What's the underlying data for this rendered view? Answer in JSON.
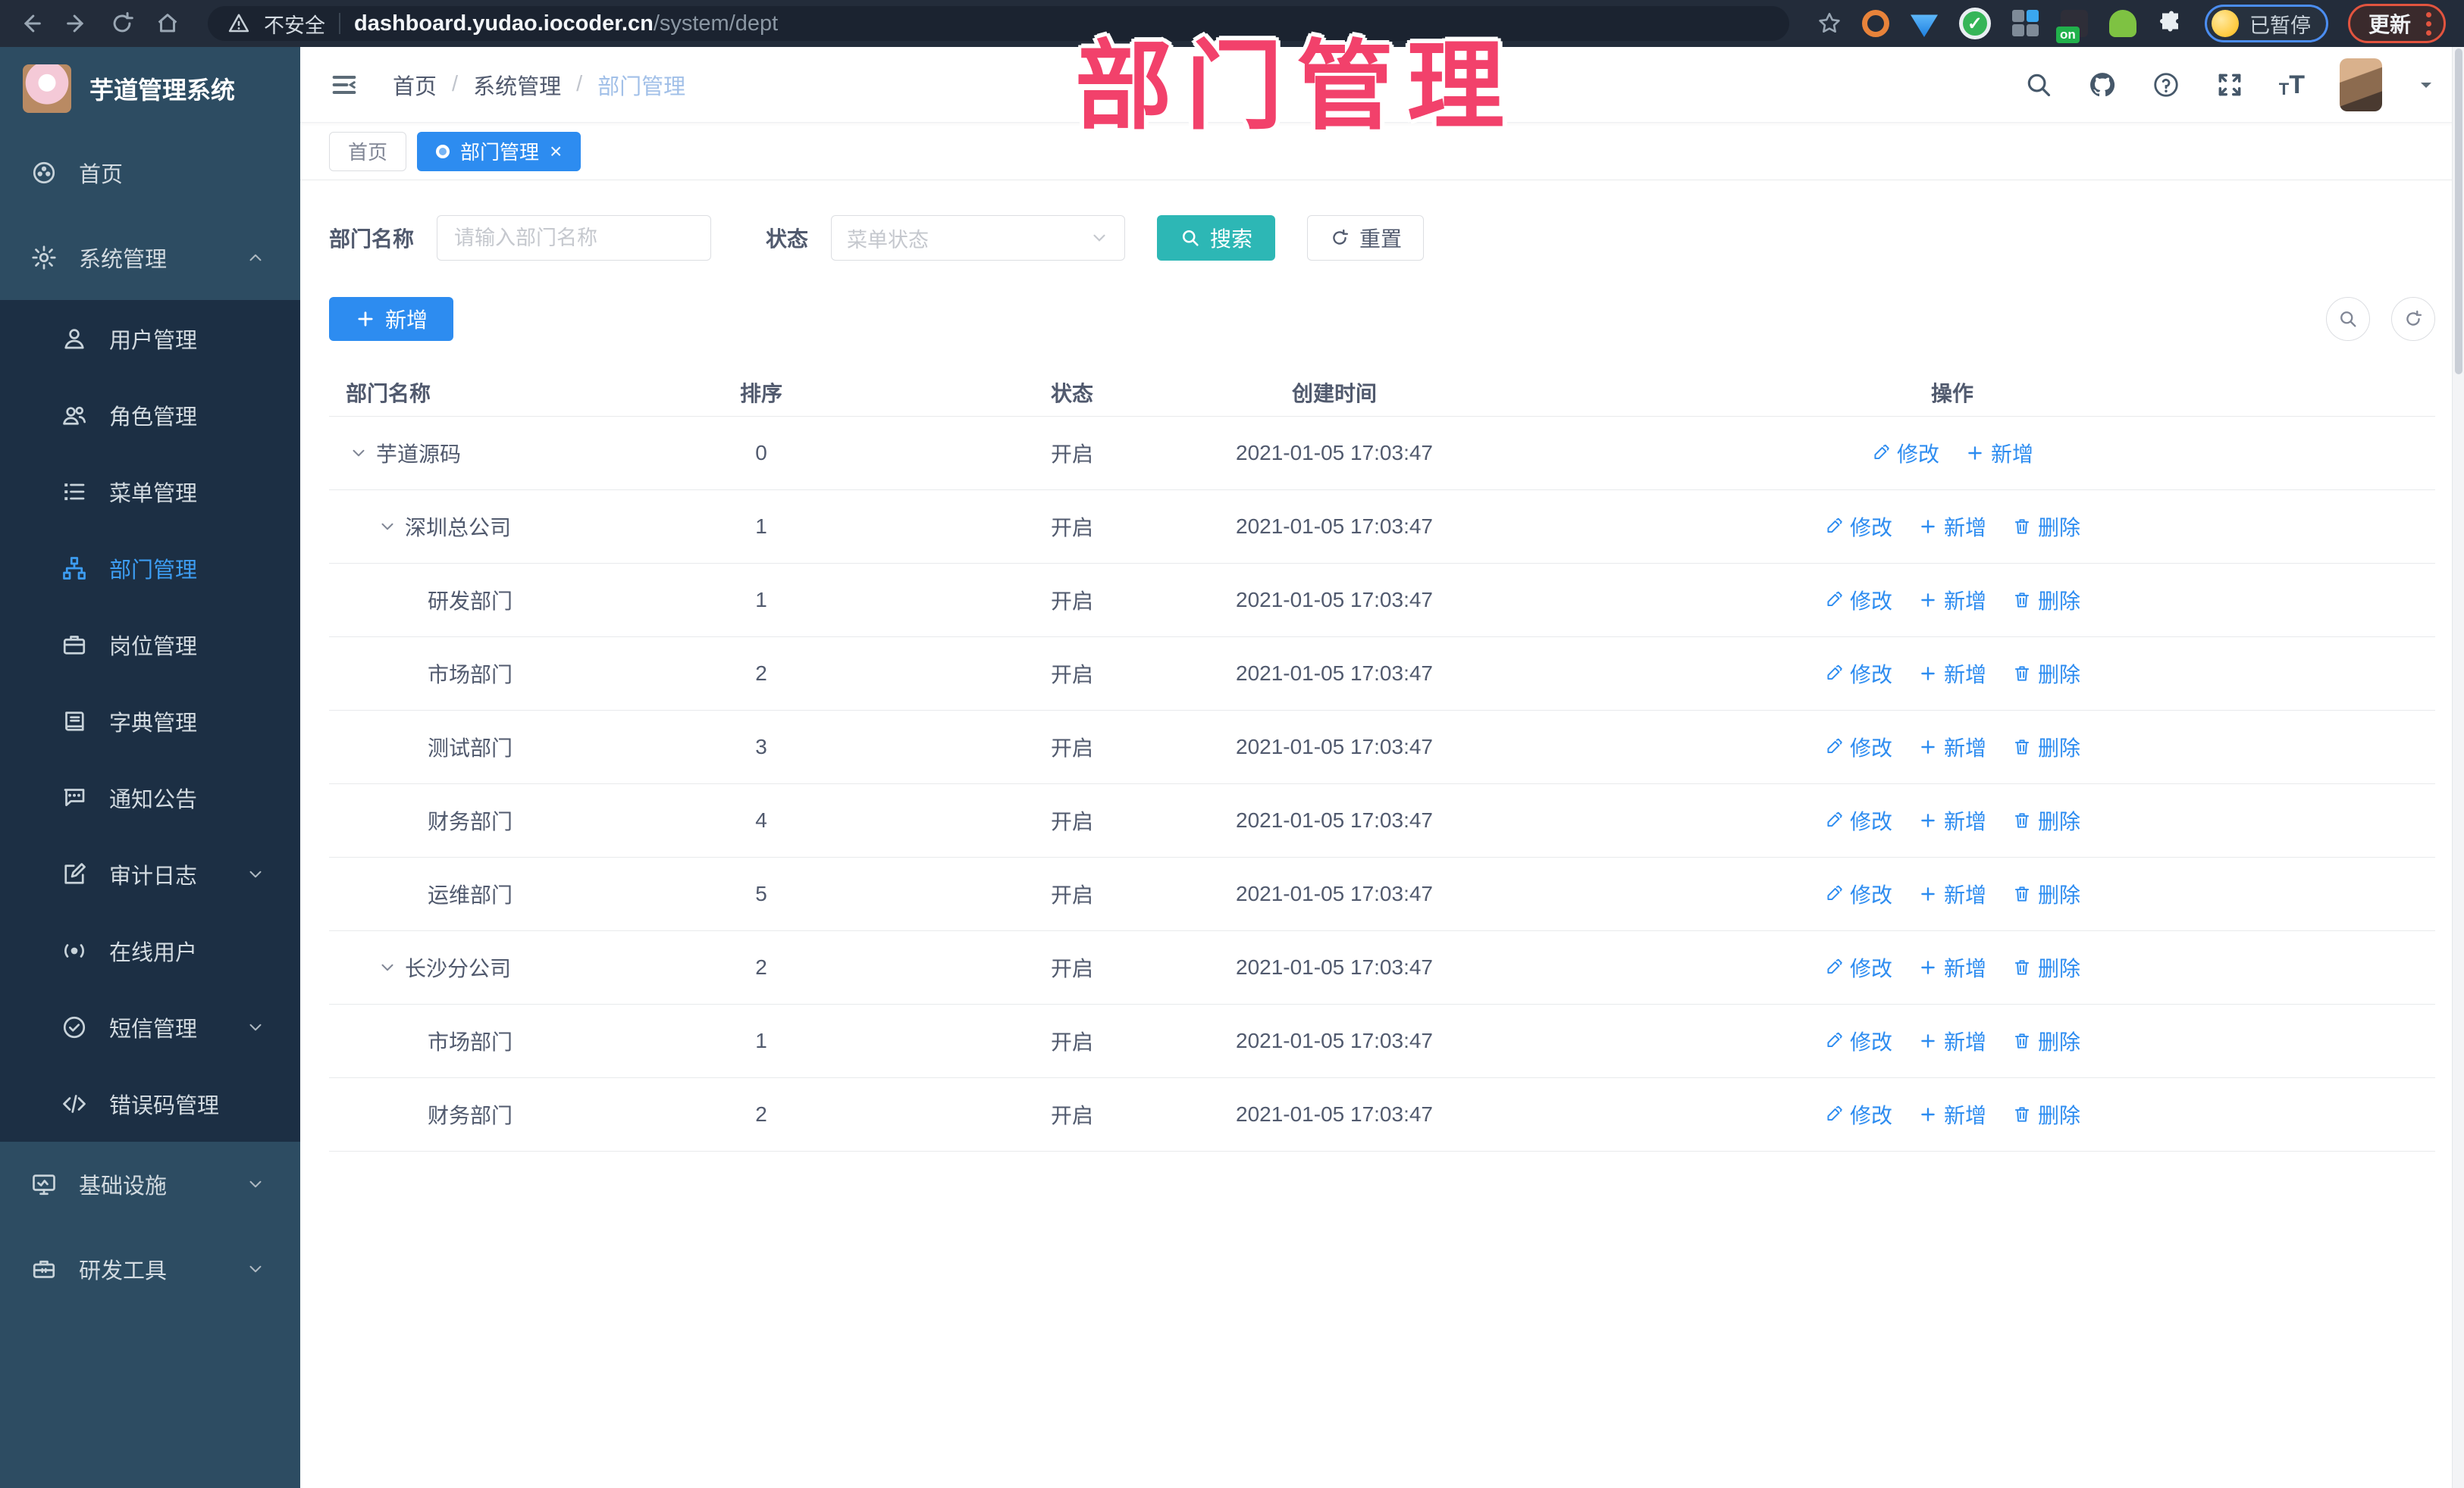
{
  "colors": {
    "primary": "#2d8cf0",
    "info": "#2db7b5",
    "annotation": "#f2416b",
    "sidebar": "#2d4c62",
    "sidebar_submenu": "#1c2f44",
    "browser_bar": "#232c3a"
  },
  "annotation": {
    "text": "部门管理"
  },
  "browser": {
    "security_label": "不安全",
    "url_domain": "dashboard.yudao.iocoder.cn",
    "url_path": "/system/dept",
    "paused_label": "已暂停",
    "update_label": "更新"
  },
  "app": {
    "title": "芋道管理系统"
  },
  "sidebar": {
    "items": [
      {
        "id": "home",
        "label": "首页",
        "icon": "dashboard-icon",
        "level": "top"
      },
      {
        "id": "system",
        "label": "系统管理",
        "icon": "gear-icon",
        "level": "top",
        "chevron": "up"
      },
      {
        "id": "user",
        "label": "用户管理",
        "icon": "user-icon",
        "level": "sub"
      },
      {
        "id": "role",
        "label": "角色管理",
        "icon": "users-icon",
        "level": "sub"
      },
      {
        "id": "menu",
        "label": "菜单管理",
        "icon": "list-icon",
        "level": "sub"
      },
      {
        "id": "dept",
        "label": "部门管理",
        "icon": "org-tree-icon",
        "level": "sub",
        "active": true
      },
      {
        "id": "post",
        "label": "岗位管理",
        "icon": "briefcase-icon",
        "level": "sub"
      },
      {
        "id": "dict",
        "label": "字典管理",
        "icon": "book-icon",
        "level": "sub"
      },
      {
        "id": "notice",
        "label": "通知公告",
        "icon": "chat-icon",
        "level": "sub"
      },
      {
        "id": "audit",
        "label": "审计日志",
        "icon": "edit-square-icon",
        "level": "sub",
        "chevron": "down"
      },
      {
        "id": "online",
        "label": "在线用户",
        "icon": "broadcast-icon",
        "level": "sub"
      },
      {
        "id": "sms",
        "label": "短信管理",
        "icon": "badge-check-icon",
        "level": "sub",
        "chevron": "down"
      },
      {
        "id": "errcode",
        "label": "错误码管理",
        "icon": "code-icon",
        "level": "sub"
      },
      {
        "id": "infra",
        "label": "基础设施",
        "icon": "monitor-icon",
        "level": "top",
        "chevron": "down"
      },
      {
        "id": "tools",
        "label": "研发工具",
        "icon": "toolbox-icon",
        "level": "top",
        "chevron": "down"
      }
    ]
  },
  "header": {
    "breadcrumb": [
      "首页",
      "系统管理",
      "部门管理"
    ]
  },
  "tabs": [
    {
      "id": "home",
      "label": "首页",
      "active": false,
      "closable": false
    },
    {
      "id": "dept",
      "label": "部门管理",
      "active": true,
      "closable": true
    }
  ],
  "filters": {
    "name_label": "部门名称",
    "name_placeholder": "请输入部门名称",
    "status_label": "状态",
    "status_placeholder": "菜单状态",
    "search_label": "搜索",
    "reset_label": "重置"
  },
  "toolbar": {
    "add_label": "新增"
  },
  "table": {
    "columns": [
      "部门名称",
      "排序",
      "状态",
      "创建时间",
      "操作"
    ],
    "action_labels": {
      "modify": "修改",
      "add": "新增",
      "delete": "删除"
    },
    "rows": [
      {
        "name": "芋道源码",
        "level": 0,
        "expandable": true,
        "sort": "0",
        "status": "开启",
        "created": "2021-01-05 17:03:47",
        "actions": [
          "modify",
          "add"
        ]
      },
      {
        "name": "深圳总公司",
        "level": 1,
        "expandable": true,
        "sort": "1",
        "status": "开启",
        "created": "2021-01-05 17:03:47",
        "actions": [
          "modify",
          "add",
          "delete"
        ]
      },
      {
        "name": "研发部门",
        "level": 2,
        "expandable": false,
        "sort": "1",
        "status": "开启",
        "created": "2021-01-05 17:03:47",
        "actions": [
          "modify",
          "add",
          "delete"
        ]
      },
      {
        "name": "市场部门",
        "level": 2,
        "expandable": false,
        "sort": "2",
        "status": "开启",
        "created": "2021-01-05 17:03:47",
        "actions": [
          "modify",
          "add",
          "delete"
        ]
      },
      {
        "name": "测试部门",
        "level": 2,
        "expandable": false,
        "sort": "3",
        "status": "开启",
        "created": "2021-01-05 17:03:47",
        "actions": [
          "modify",
          "add",
          "delete"
        ]
      },
      {
        "name": "财务部门",
        "level": 2,
        "expandable": false,
        "sort": "4",
        "status": "开启",
        "created": "2021-01-05 17:03:47",
        "actions": [
          "modify",
          "add",
          "delete"
        ]
      },
      {
        "name": "运维部门",
        "level": 2,
        "expandable": false,
        "sort": "5",
        "status": "开启",
        "created": "2021-01-05 17:03:47",
        "actions": [
          "modify",
          "add",
          "delete"
        ]
      },
      {
        "name": "长沙分公司",
        "level": 1,
        "expandable": true,
        "sort": "2",
        "status": "开启",
        "created": "2021-01-05 17:03:47",
        "actions": [
          "modify",
          "add",
          "delete"
        ]
      },
      {
        "name": "市场部门",
        "level": 2,
        "expandable": false,
        "sort": "1",
        "status": "开启",
        "created": "2021-01-05 17:03:47",
        "actions": [
          "modify",
          "add",
          "delete"
        ]
      },
      {
        "name": "财务部门",
        "level": 2,
        "expandable": false,
        "sort": "2",
        "status": "开启",
        "created": "2021-01-05 17:03:47",
        "actions": [
          "modify",
          "add",
          "delete"
        ]
      }
    ]
  }
}
